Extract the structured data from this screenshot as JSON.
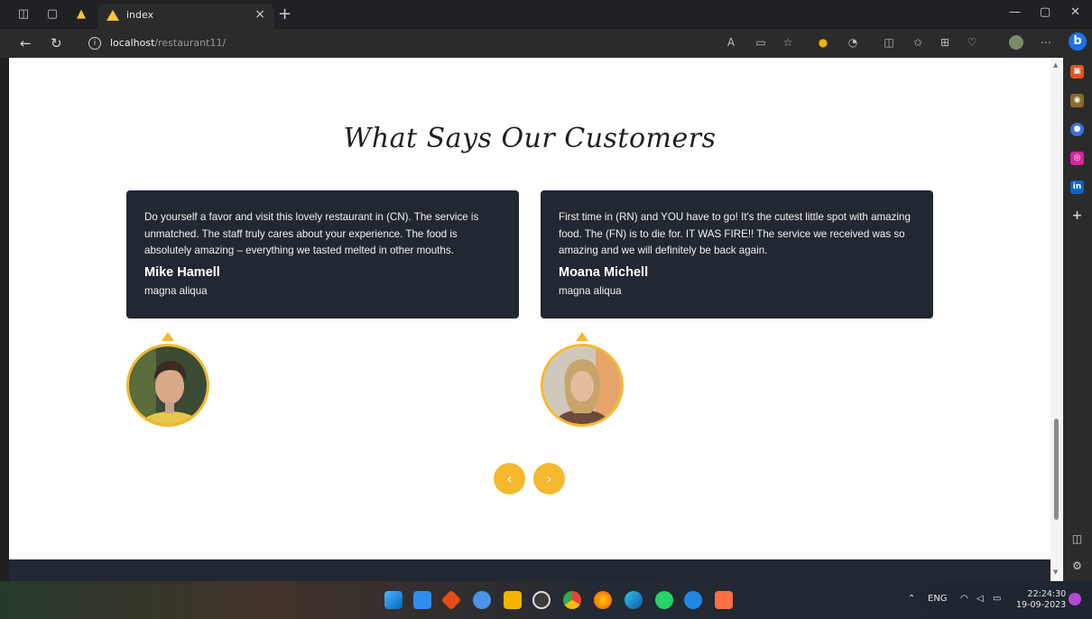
{
  "browser": {
    "tab_title": "index",
    "url_host": "localhost",
    "url_path": "/restaurant11/"
  },
  "section": {
    "heading": "What Says Our Customers"
  },
  "testimonials": [
    {
      "text": "Do yourself a favor and visit this lovely restaurant in (CN). The service is unmatched. The staff truly cares about your experience. The food is absolutely amazing – everything we tasted melted in other mouths.",
      "name": "Mike Hamell",
      "role": "magna aliqua"
    },
    {
      "text": "First time in (RN) and YOU have to go! It's the cutest little spot with amazing food. The (FN) is to die for. IT WAS FIRE!! The service we received was so amazing and we will definitely be back again.",
      "name": "Moana Michell",
      "role": "magna aliqua"
    }
  ],
  "carousel": {
    "prev": "‹",
    "next": "›"
  },
  "taskbar": {
    "lang": "ENG",
    "time": "22:24:30",
    "date": "19-09-2023"
  },
  "colors": {
    "accent": "#f5b82e",
    "card_bg": "#222831"
  }
}
